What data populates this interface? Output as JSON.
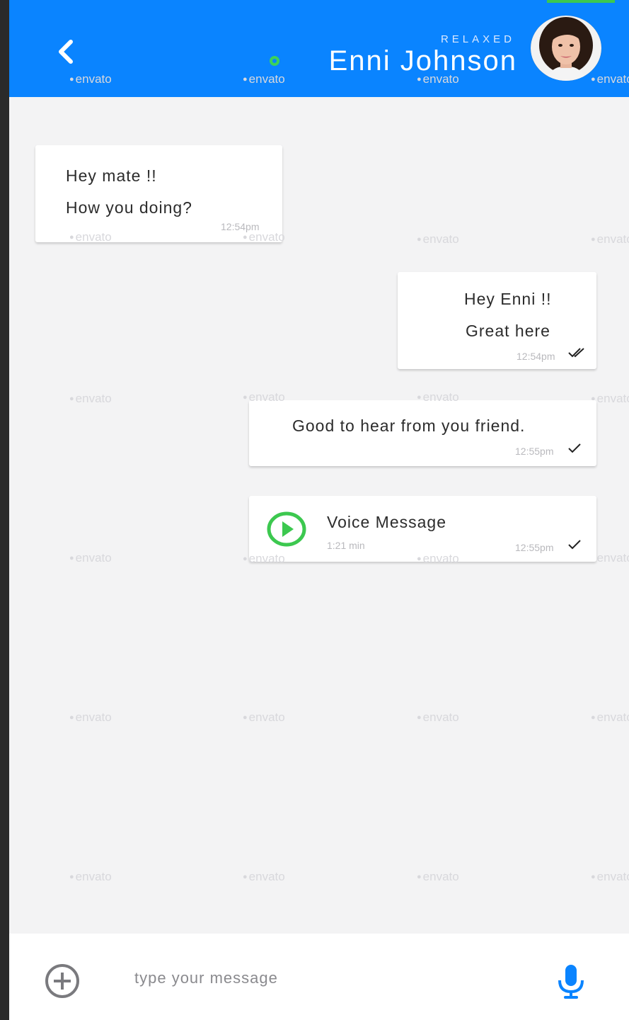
{
  "header": {
    "status": "RELAXED",
    "contact_name": "Enni Johnson"
  },
  "colors": {
    "header_bg": "#0a84ff",
    "online": "#3cd15a",
    "play": "#3cc84f",
    "mic": "#0a84ff"
  },
  "watermark": "envato",
  "messages": [
    {
      "direction": "incoming",
      "lines": [
        "Hey mate !!",
        "How you doing?"
      ],
      "time": "12:54pm"
    },
    {
      "direction": "outgoing",
      "lines": [
        "Hey Enni !!",
        "Great here"
      ],
      "time": "12:54pm",
      "status": "read"
    },
    {
      "direction": "outgoing",
      "lines": [
        "Good to hear from you friend."
      ],
      "time": "12:55pm",
      "status": "sent"
    },
    {
      "direction": "outgoing",
      "type": "voice",
      "title": "Voice Message",
      "duration": "1:21 min",
      "time": "12:55pm",
      "status": "sent"
    }
  ],
  "composer": {
    "placeholder": "type your message",
    "value": ""
  },
  "icons": {
    "back": "chevron-left-icon",
    "add": "plus-circle-icon",
    "mic": "microphone-icon",
    "play": "play-circle-icon",
    "single_tick": "check-icon",
    "double_tick": "double-check-icon"
  }
}
